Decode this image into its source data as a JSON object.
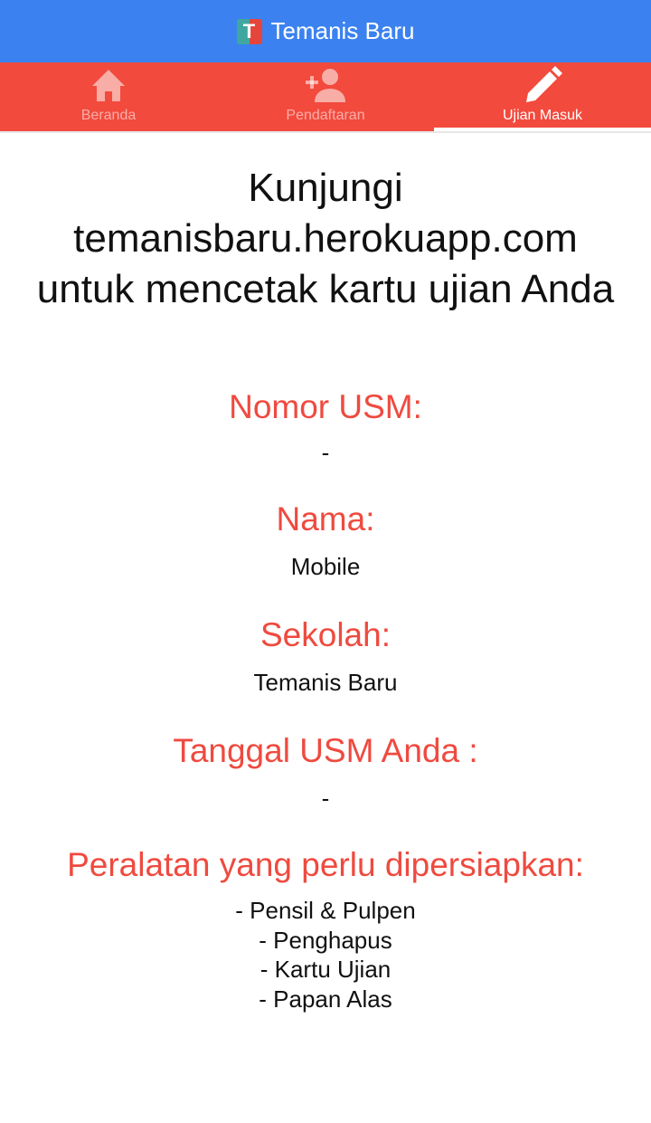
{
  "app": {
    "title": "Temanis Baru",
    "logo_letter": "T"
  },
  "tabs": [
    {
      "label": "Beranda",
      "icon": "home-icon",
      "active": false
    },
    {
      "label": "Pendaftaran",
      "icon": "person-add-icon",
      "active": false
    },
    {
      "label": "Ujian Masuk",
      "icon": "pencil-icon",
      "active": true
    }
  ],
  "main": {
    "headline": "Kunjungi temanisbaru.herokuapp.com untuk mencetak kartu ujian Anda",
    "nomor_title": "Nomor USM:",
    "nomor_value": "-",
    "nama_title": "Nama:",
    "nama_value": "Mobile",
    "sekolah_title": "Sekolah:",
    "sekolah_value": "Temanis Baru",
    "tanggal_title": "Tanggal USM Anda :",
    "tanggal_value": "-",
    "peralatan_title": "Peralatan yang perlu dipersiapkan:",
    "peralatan_items": [
      "- Pensil & Pulpen",
      "- Penghapus",
      "- Kartu Ujian",
      "- Papan Alas"
    ]
  },
  "colors": {
    "app_bar": "#3b82f0",
    "tab_bar": "#f24a3d",
    "accent_text": "#ef4a3f"
  }
}
